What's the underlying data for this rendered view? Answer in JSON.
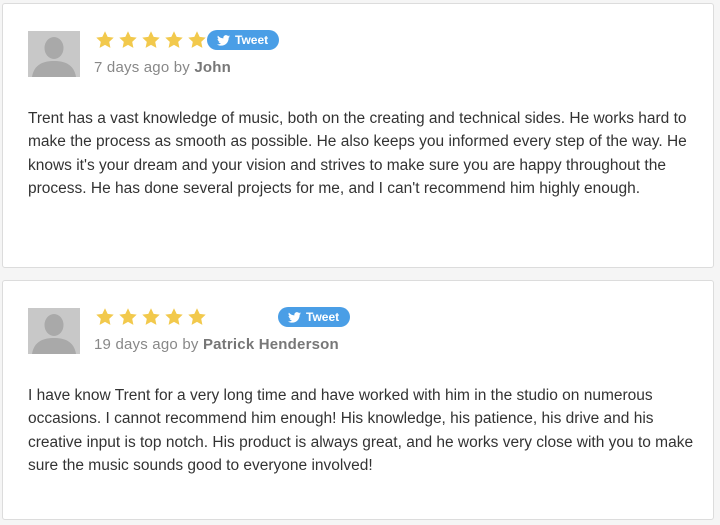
{
  "colors": {
    "star": "#f2c94c",
    "tweet_button": "#4a9ee6",
    "avatar": "#c8c8c8",
    "card_border": "#dcdcdc"
  },
  "icons": {
    "avatar": "person-silhouette-icon",
    "star": "star-icon",
    "tweet": "twitter-bird-icon"
  },
  "reviews": [
    {
      "rating": 5,
      "rating_max": 5,
      "tweet_label": "Tweet",
      "date": "7 days ago",
      "by": "by",
      "author": "John",
      "text": "Trent has a vast knowledge of music, both on the creating and technical sides. He works hard to make the process as smooth as possible. He also keeps you informed every step of the way. He knows it's your dream and your vision and strives to make sure you are happy throughout the process. He has done several projects for me, and I can't recommend him highly enough."
    },
    {
      "rating": 5,
      "rating_max": 5,
      "tweet_label": "Tweet",
      "date": "19 days ago",
      "by": "by",
      "author": "Patrick Henderson",
      "text": "I have know Trent for a very long time and have worked with him in the studio on numerous occasions. I cannot recommend him enough! His knowledge, his patience, his drive and his creative input is top notch. His product is always great, and he works very close with you to make sure the music sounds good to everyone involved!"
    }
  ]
}
